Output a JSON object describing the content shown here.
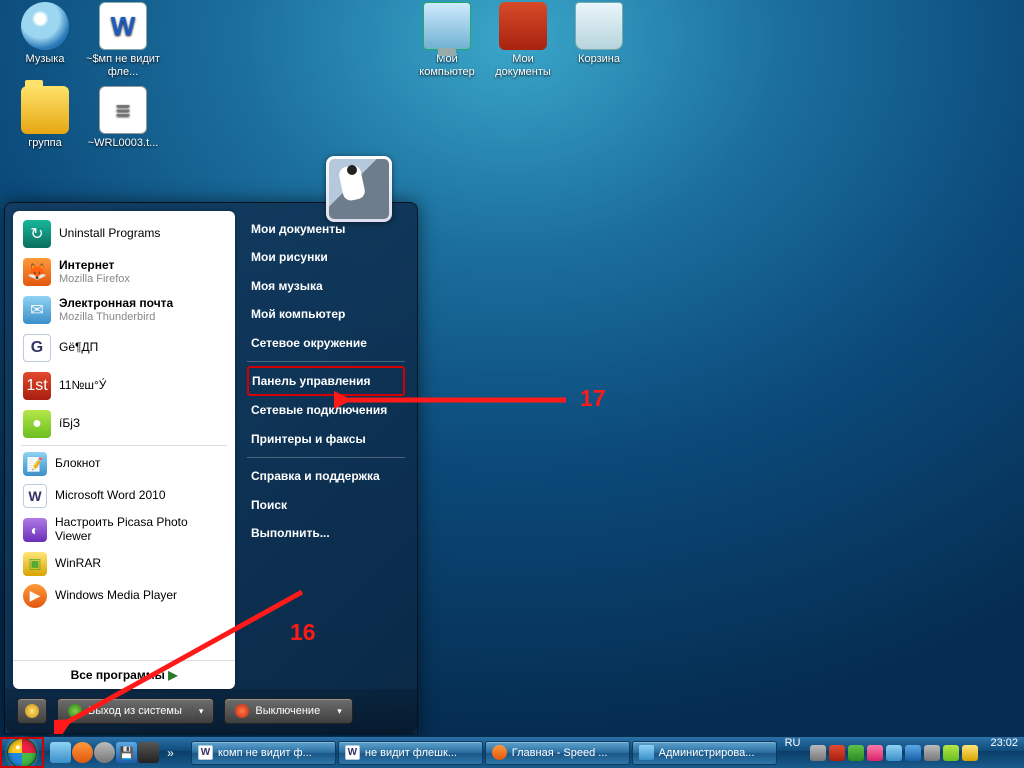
{
  "desktop_icons": {
    "music": "Музыка",
    "smp": "~$мп не видит фле...",
    "group": "группа",
    "wrl": "~WRL0003.t...",
    "mycomp": "Мой\nкомпьютер",
    "mydocs": "Мои\nдокументы",
    "bin": "Корзина"
  },
  "start_menu": {
    "pinned": [
      {
        "label": "Uninstall Programs",
        "sub": ""
      },
      {
        "label": "Интернет",
        "sub": "Mozilla Firefox"
      },
      {
        "label": "Электронная почта",
        "sub": "Mozilla Thunderbird"
      },
      {
        "label": "Gë¶ДП",
        "sub": ""
      },
      {
        "label": "11№ш°У́",
        "sub": ""
      },
      {
        "label": "íБjЗ",
        "sub": ""
      }
    ],
    "recent": [
      {
        "label": "Блокнот"
      },
      {
        "label": "Microsoft Word 2010"
      },
      {
        "label": "Настроить Picasa Photo Viewer"
      },
      {
        "label": "WinRAR"
      },
      {
        "label": "Windows Media Player"
      }
    ],
    "all_programs": "Все программы",
    "right": [
      "Мои документы",
      "Мои рисунки",
      "Моя музыка",
      "Мой компьютер",
      "Сетевое окружение"
    ],
    "right2_boxed": "Панель управления",
    "right2_rest": [
      "Сетевые подключения",
      "Принтеры и факсы"
    ],
    "right3": [
      "Справка и поддержка",
      "Поиск",
      "Выполнить..."
    ],
    "buttons": {
      "logoff": "Выход из системы",
      "shutdown": "Выключение"
    }
  },
  "annotations": {
    "n16": "16",
    "n17": "17"
  },
  "taskbar": {
    "tasks": [
      "комп не видит ф...",
      "не видит флешк...",
      "Главная - Speed ...",
      "Администрирова..."
    ],
    "lang": "RU",
    "clock": "23:02"
  }
}
